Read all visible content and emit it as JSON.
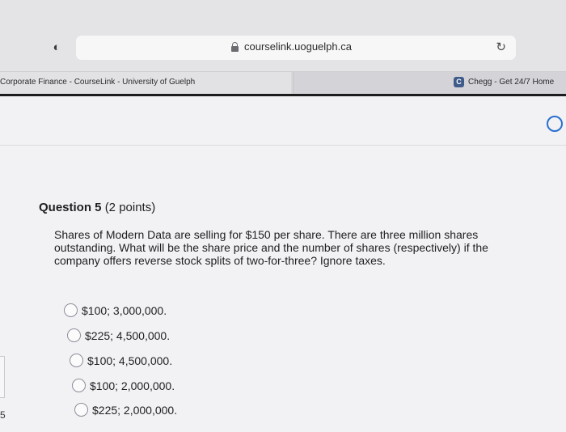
{
  "browser": {
    "url": "courselink.uoguelph.ca",
    "tabs": [
      {
        "label": "Corporate Finance - CourseLink - University of Guelph"
      },
      {
        "label": "Chegg - Get 24/7 Home"
      }
    ],
    "chegg_badge": "C"
  },
  "question": {
    "number_label": "Question 5",
    "points": "(2 points)",
    "text": "Shares of Modern Data are selling for $150 per share. There are three million shares outstanding. What will be the share price and the number of shares (respectively) if the company offers reverse stock splits of two-for-three? Ignore taxes.",
    "options": [
      {
        "label": "$100; 3,000,000."
      },
      {
        "label": "$225; 4,500,000."
      },
      {
        "label": "$100; 4,500,000."
      },
      {
        "label": "$100; 2,000,000."
      },
      {
        "label": "$225; 2,000,000."
      }
    ]
  },
  "corner_text": "5",
  "colors": {
    "accent": "#2a6fd0"
  }
}
